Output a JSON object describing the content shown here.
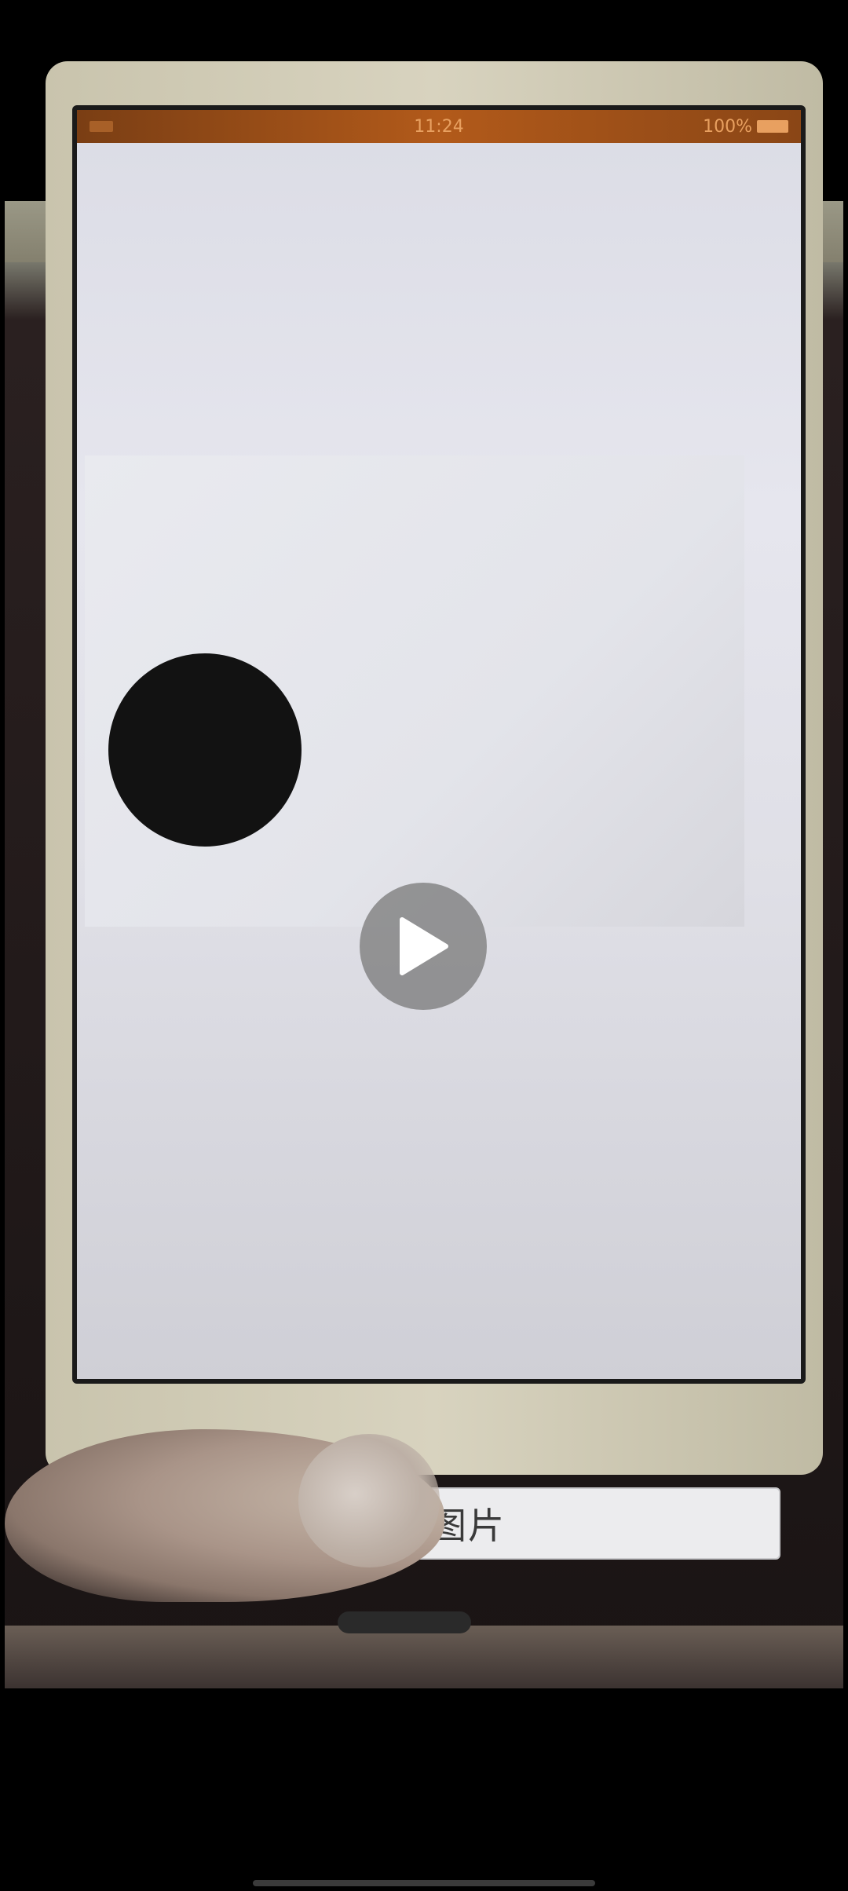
{
  "status_bar": {
    "time": "11:24",
    "battery": "100%"
  },
  "button": {
    "label": "示图片"
  },
  "icons": {
    "play": "play-icon"
  },
  "colors": {
    "background": "#000000",
    "status_bar": "#b25a1a",
    "play_overlay": "#787878"
  }
}
